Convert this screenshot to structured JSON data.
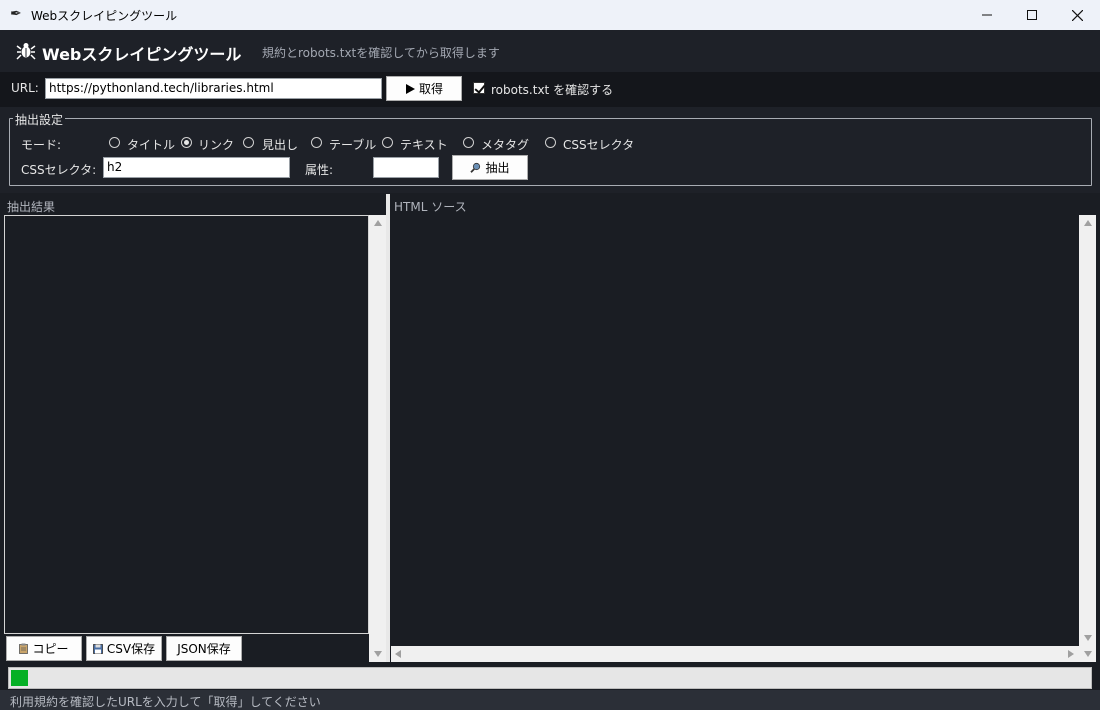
{
  "window": {
    "title": "Webスクレイピングツール",
    "icon": "feather-icon"
  },
  "header": {
    "title": "Webスクレイピングツール",
    "subtitle": "規約とrobots.txtを確認してから取得します",
    "icon": "bug-icon"
  },
  "url_row": {
    "label": "URL:",
    "value": "https://pythonland.tech/libraries.html",
    "fetch_label": "取得",
    "robots_label": "robots.txt を確認する",
    "robots_checked": true
  },
  "settings": {
    "frame_title": "抽出設定",
    "mode_label": "モード:",
    "modes": [
      {
        "label": "タイトル",
        "selected": false
      },
      {
        "label": "リンク",
        "selected": true
      },
      {
        "label": "見出し",
        "selected": false
      },
      {
        "label": "テーブル",
        "selected": false
      },
      {
        "label": "テキスト",
        "selected": false
      },
      {
        "label": "メタタグ",
        "selected": false
      },
      {
        "label": "CSSセレクタ",
        "selected": false
      }
    ],
    "css_label": "CSSセレクタ:",
    "css_value": "h2",
    "attr_label": "属性:",
    "attr_value": "",
    "extract_label": "抽出"
  },
  "results": {
    "label": "抽出結果",
    "copy_label": "コピー",
    "csv_label": "CSV保存",
    "json_label": "JSON保存"
  },
  "source": {
    "label": "HTML ソース"
  },
  "progress": {
    "fraction": 0.016
  },
  "status": {
    "text": "利用規約を確認したURLを入力して「取得」してください"
  },
  "colors": {
    "bg": "#1a1d23",
    "header": "#1e2128",
    "progress": "#06b025"
  }
}
